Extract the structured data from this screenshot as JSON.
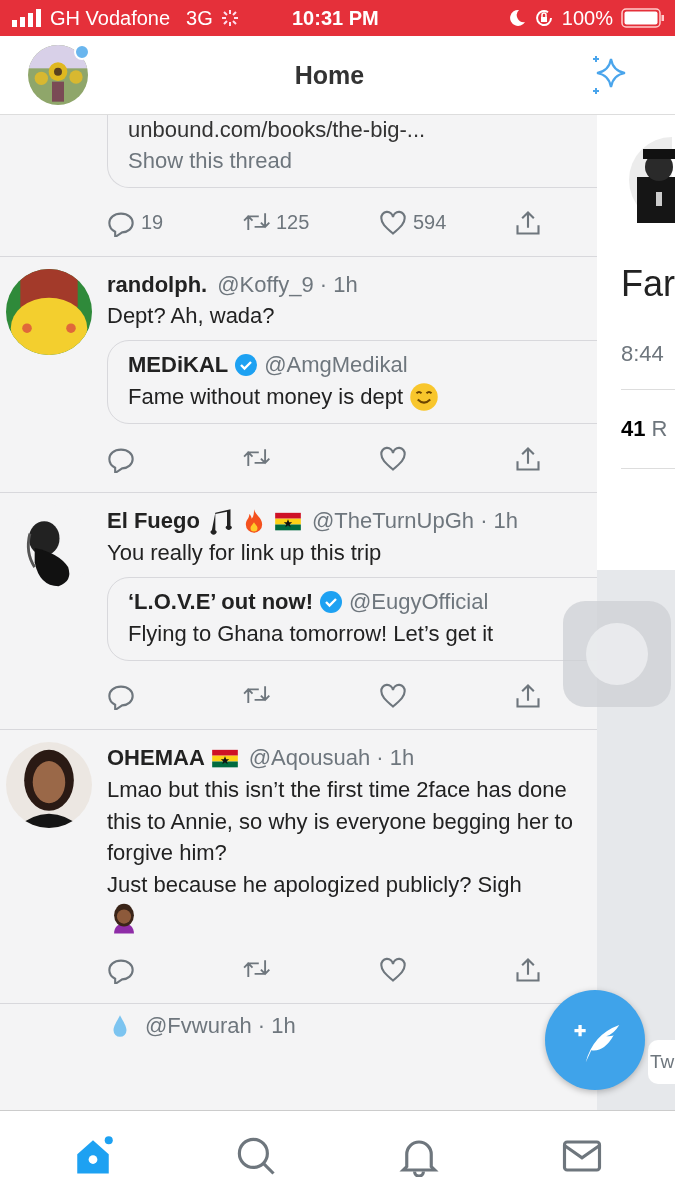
{
  "status_bar": {
    "carrier": "GH Vodafone",
    "network": "3G",
    "time": "10:31 PM",
    "battery": "100%"
  },
  "header": {
    "title": "Home"
  },
  "feed": [
    {
      "kind": "thread_tail",
      "link": "unbound.com/books/the-big-...",
      "show_thread": "Show this thread",
      "actions": {
        "replies": "19",
        "retweets": "125",
        "likes": "594"
      }
    },
    {
      "kind": "tweet",
      "name": "randolph.",
      "handle": "@Koffy_9 · 1h",
      "text": "Dept? Ah, wada?",
      "quote": {
        "name": "MEDiKAL",
        "verified": true,
        "handle": "@AmgMedikal",
        "text": "Fame without money is dept",
        "emoji": [
          {
            "kind": "smile"
          }
        ]
      }
    },
    {
      "kind": "tweet",
      "name": "El Fuego",
      "name_emoji": [
        {
          "kind": "notes"
        },
        {
          "kind": "fire"
        },
        {
          "kind": "flag"
        }
      ],
      "handle": "@TheTurnUpGh · 1h",
      "text": "You really for link up this trip",
      "quote": {
        "name": "‘L.O.V.E’ out now!",
        "verified": true,
        "handle": "@EugyOfficial",
        "text": "Flying to Ghana tomorrow! Let’s get it"
      }
    },
    {
      "kind": "tweet",
      "name": "OHEMAA",
      "name_emoji": [
        {
          "kind": "flag"
        }
      ],
      "handle": "@Aqousuah · 1h",
      "text": "Lmao but this isn’t the first time 2face has done this to Annie, so why is everyone begging her to forgive him?\nJust because he apologized publicly? Sigh",
      "text_emoji": [
        {
          "kind": "woman"
        }
      ]
    },
    {
      "kind": "partial",
      "name_emoji": [
        {
          "kind": "drop"
        }
      ],
      "handle": "@Fvwurah · 1h"
    }
  ],
  "side_panel": {
    "title": "Far",
    "time": "8:44",
    "count": "41",
    "count_label": "R",
    "reply_hint": "Tw"
  },
  "tab_bar": [
    {
      "kind": "home",
      "selected": true
    },
    {
      "kind": "search",
      "selected": false
    },
    {
      "kind": "bell",
      "selected": false
    },
    {
      "kind": "mail",
      "selected": false
    }
  ]
}
